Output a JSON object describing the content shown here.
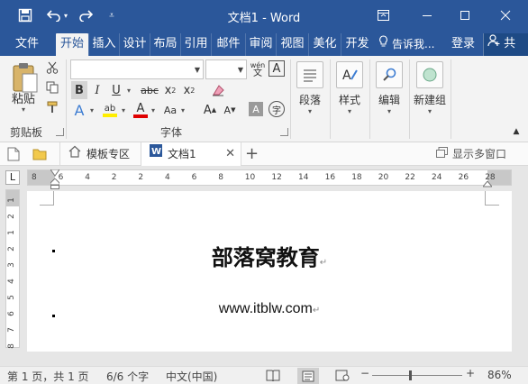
{
  "window": {
    "title": "文档1 - Word",
    "qat": {
      "save_icon": "save-icon",
      "undo_icon": "undo-icon",
      "redo_icon": "redo-icon",
      "customize_icon": "qat-menu-icon"
    },
    "controls": {
      "restore": "ribbon-display-options-icon",
      "minimize": "minimize-icon",
      "maximize": "maximize-icon",
      "close": "close-icon"
    }
  },
  "tabs": [
    {
      "label": "文件"
    },
    {
      "label": "开始",
      "active": true
    },
    {
      "label": "插入"
    },
    {
      "label": "设计"
    },
    {
      "label": "布局"
    },
    {
      "label": "引用"
    },
    {
      "label": "邮件"
    },
    {
      "label": "审阅"
    },
    {
      "label": "视图"
    },
    {
      "label": "美化"
    },
    {
      "label": "开发"
    }
  ],
  "tell_me": "告诉我...",
  "login": "登录",
  "share": "共",
  "ribbon": {
    "clipboard": {
      "paste": "粘贴",
      "group": "剪贴板"
    },
    "font": {
      "font_name": "",
      "font_size": "",
      "phonetic": "wén",
      "group": "字体",
      "bold": "B",
      "italic": "I",
      "underline": "U",
      "strike": "abc",
      "subscript": "x",
      "superscript": "x",
      "highlight": "ab",
      "font_color": "A",
      "grow": "A",
      "shrink": "A",
      "text_effects": "A",
      "char_shading": "A",
      "enclose": "字",
      "char_border": "A",
      "change_case": "Aa"
    },
    "paragraph": "段落",
    "styles": "样式",
    "editing": "编辑",
    "new_group": "新建组"
  },
  "doc_tabs": {
    "template": "模板专区",
    "document": "文档1",
    "multi_window": "显示多窗口"
  },
  "ruler": {
    "ticks": [
      "8",
      "6",
      "4",
      "2",
      "2",
      "4",
      "6",
      "8",
      "10",
      "12",
      "14",
      "16",
      "18",
      "20",
      "22",
      "24",
      "26",
      "28"
    ],
    "vticks": [
      "1",
      "2",
      "1",
      "2",
      "3",
      "4",
      "5",
      "6",
      "7",
      "8"
    ]
  },
  "document": {
    "heading": "部落窝教育",
    "url": "www.itblw.com",
    "para_mark": "↵"
  },
  "status": {
    "page": "第 1 页，共 1 页",
    "words": "6/6 个字",
    "language": "中文(中国)",
    "zoom_out": "−",
    "zoom_in": "+",
    "zoom": "86%",
    "zoom_percent": 86
  }
}
